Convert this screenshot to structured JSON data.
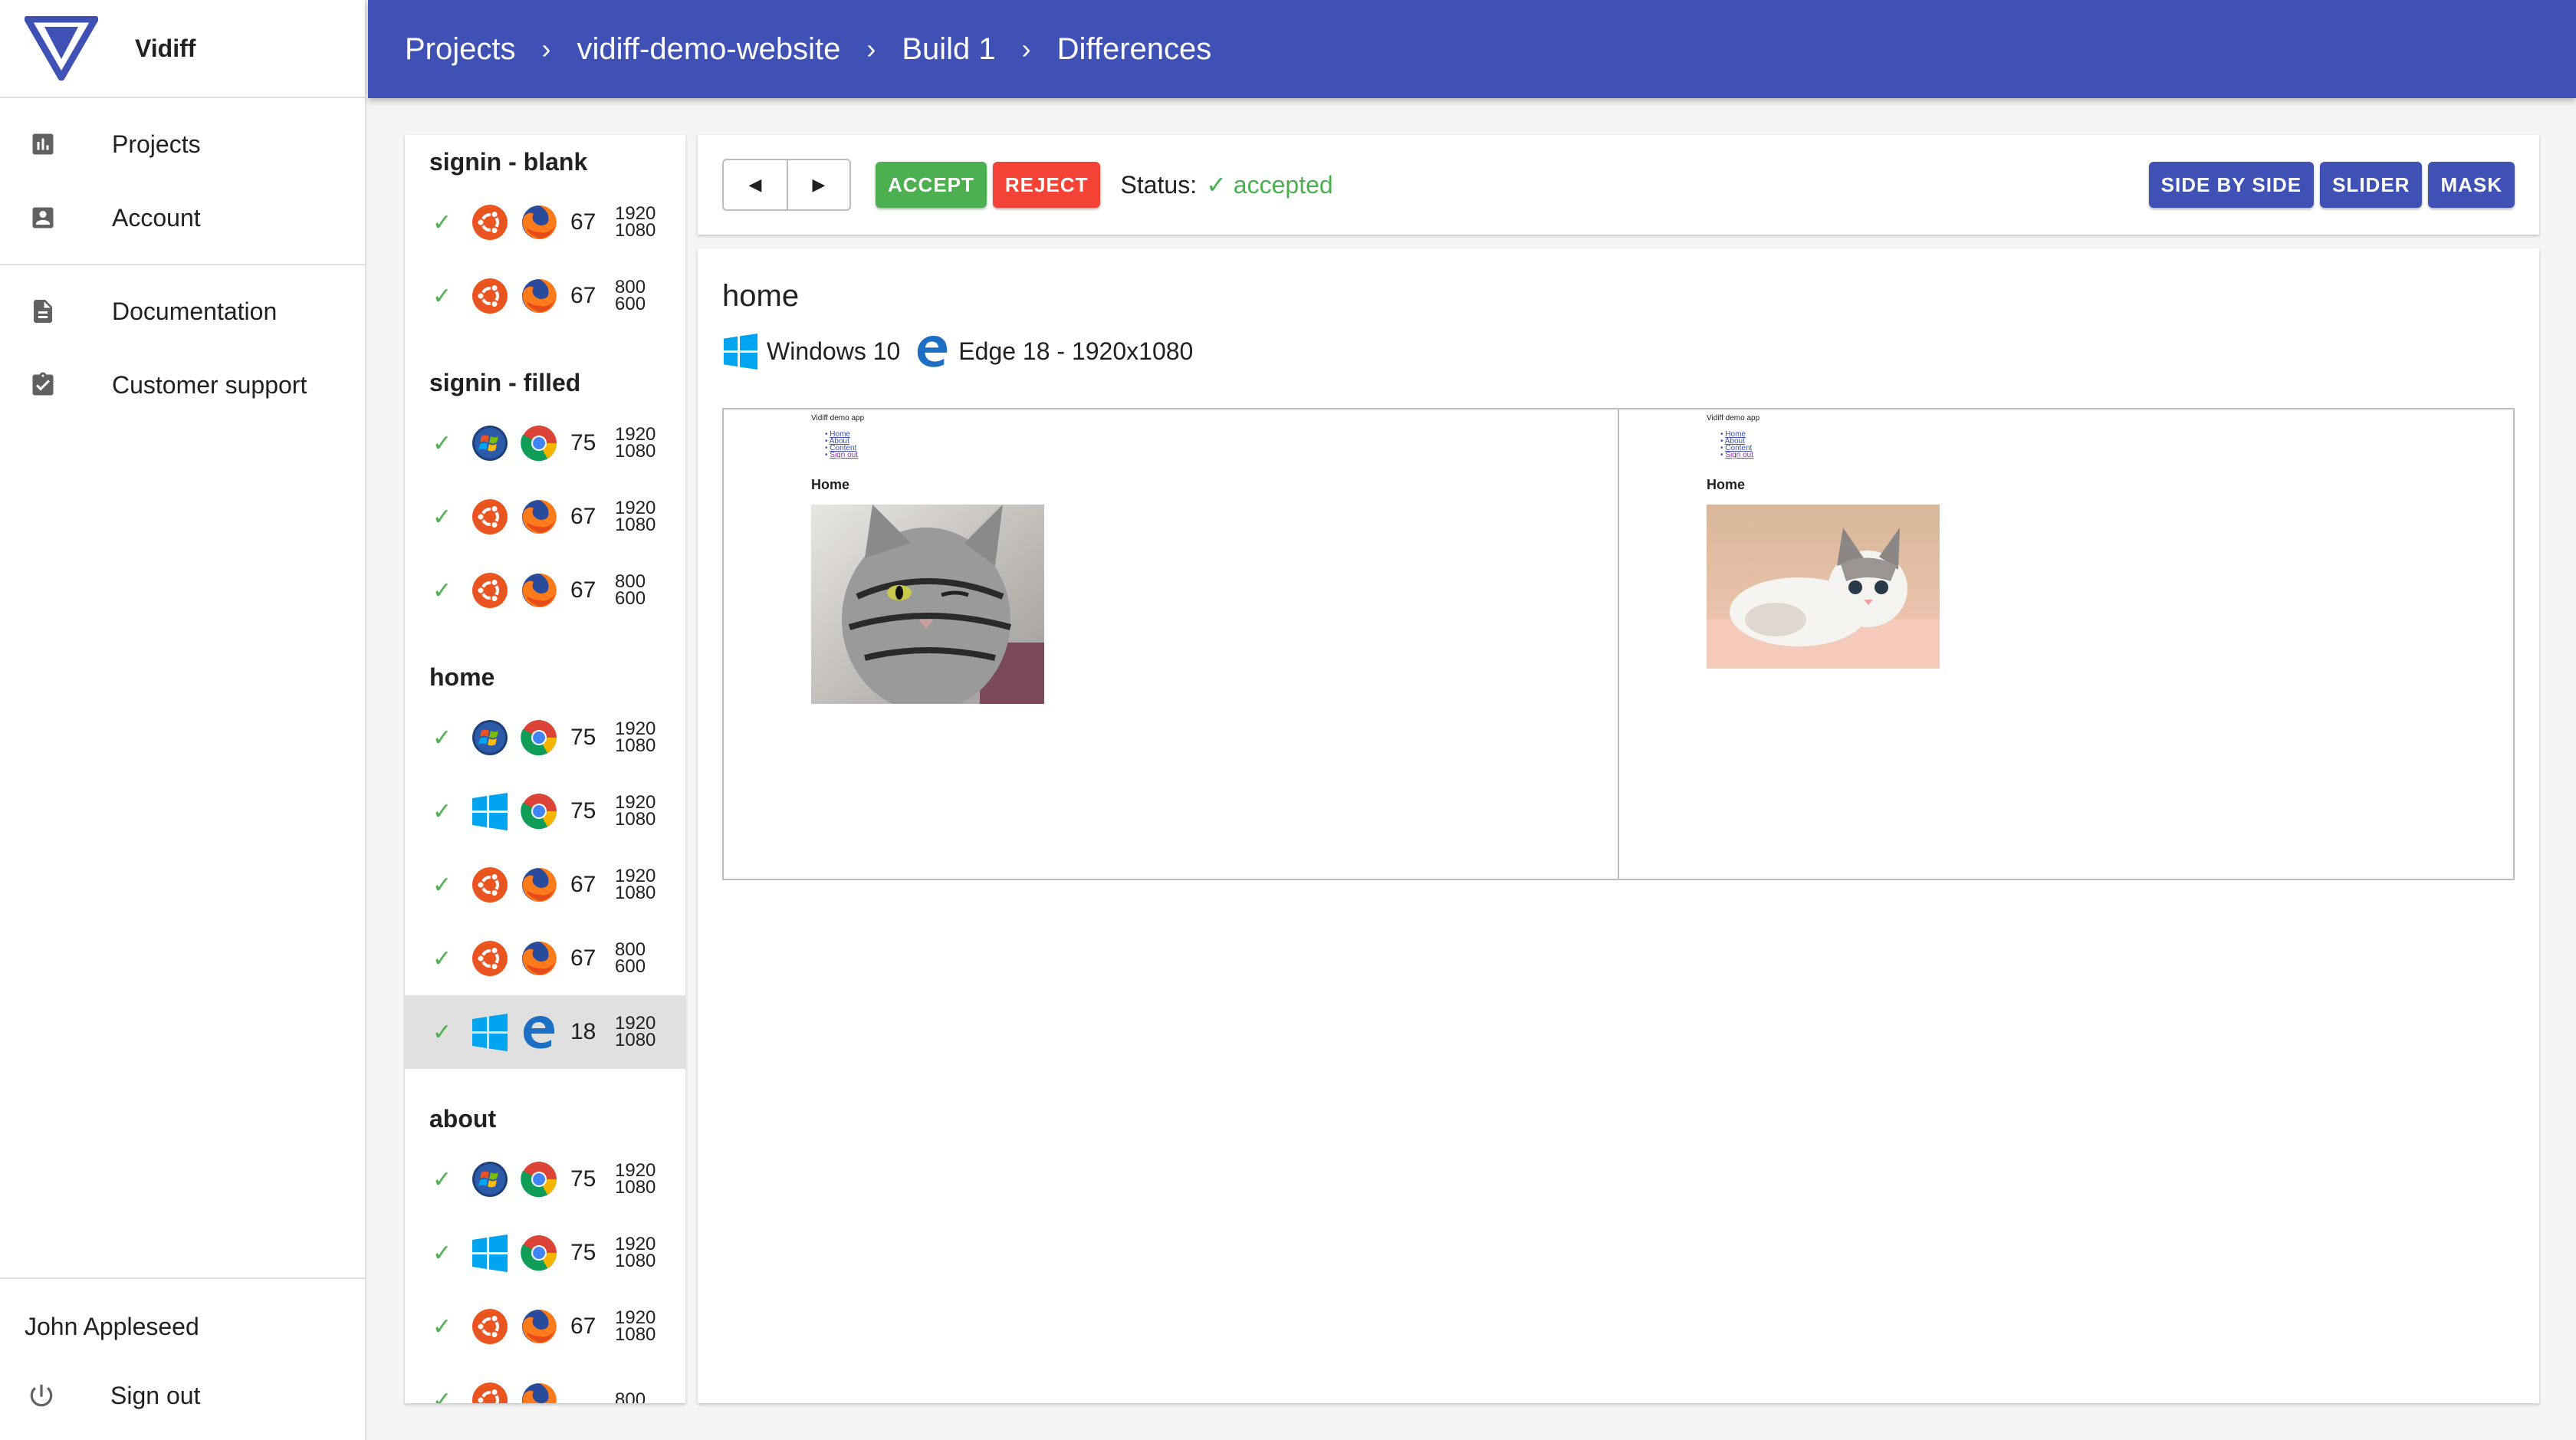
{
  "brand": {
    "name": "Vidiff"
  },
  "sidebar": {
    "nav_primary": [
      {
        "label": "Projects",
        "icon": "bar-chart-icon"
      },
      {
        "label": "Account",
        "icon": "account-box-icon"
      }
    ],
    "nav_secondary": [
      {
        "label": "Documentation",
        "icon": "document-icon"
      },
      {
        "label": "Customer support",
        "icon": "assignment-check-icon"
      }
    ],
    "user_name": "John Appleseed",
    "sign_out": "Sign out"
  },
  "breadcrumbs": [
    "Projects",
    "vidiff-demo-website",
    "Build 1",
    "Differences"
  ],
  "groups": [
    {
      "title": "signin - blank",
      "rows": [
        {
          "os": "ubuntu",
          "browser": "firefox",
          "version": "67",
          "w": "1920",
          "h": "1080"
        },
        {
          "os": "ubuntu",
          "browser": "firefox",
          "version": "67",
          "w": "800",
          "h": "600"
        }
      ]
    },
    {
      "title": "signin - filled",
      "rows": [
        {
          "os": "windows7",
          "browser": "chrome",
          "version": "75",
          "w": "1920",
          "h": "1080"
        },
        {
          "os": "ubuntu",
          "browser": "firefox",
          "version": "67",
          "w": "1920",
          "h": "1080"
        },
        {
          "os": "ubuntu",
          "browser": "firefox",
          "version": "67",
          "w": "800",
          "h": "600"
        }
      ]
    },
    {
      "title": "home",
      "rows": [
        {
          "os": "windows7",
          "browser": "chrome",
          "version": "75",
          "w": "1920",
          "h": "1080"
        },
        {
          "os": "windows10",
          "browser": "chrome",
          "version": "75",
          "w": "1920",
          "h": "1080"
        },
        {
          "os": "ubuntu",
          "browser": "firefox",
          "version": "67",
          "w": "1920",
          "h": "1080"
        },
        {
          "os": "ubuntu",
          "browser": "firefox",
          "version": "67",
          "w": "800",
          "h": "600"
        },
        {
          "os": "windows10",
          "browser": "edge",
          "version": "18",
          "w": "1920",
          "h": "1080",
          "selected": true
        }
      ]
    },
    {
      "title": "about",
      "rows": [
        {
          "os": "windows7",
          "browser": "chrome",
          "version": "75",
          "w": "1920",
          "h": "1080"
        },
        {
          "os": "windows10",
          "browser": "chrome",
          "version": "75",
          "w": "1920",
          "h": "1080"
        },
        {
          "os": "ubuntu",
          "browser": "firefox",
          "version": "67",
          "w": "1920",
          "h": "1080"
        },
        {
          "os": "ubuntu",
          "browser": "firefox",
          "version": "",
          "w": "800",
          "h": ""
        }
      ]
    }
  ],
  "toolbar": {
    "accept": "ACCEPT",
    "reject": "REJECT",
    "status_label": "Status:",
    "status_value": "accepted",
    "view_modes": [
      "SIDE BY SIDE",
      "SLIDER",
      "MASK"
    ]
  },
  "detail": {
    "test_name": "home",
    "os_name": "Windows 10",
    "browser_desc": "Edge 18 - 1920x1080"
  },
  "screenshots": [
    {
      "app_title": "Vidiff demo app",
      "links": [
        "Home",
        "About",
        "Content",
        "Sign out"
      ],
      "heading": "Home",
      "image": "gray-tabby-cat-winking"
    },
    {
      "app_title": "Vidiff demo app",
      "links": [
        "Home",
        "About",
        "Content",
        "Sign out"
      ],
      "heading": "Home",
      "image": "kitten-lying-on-blanket"
    }
  ],
  "colors": {
    "primary": "#3f51b5",
    "accept": "#4caf50",
    "reject": "#f44336",
    "selected_row": "#e0e0e0"
  }
}
